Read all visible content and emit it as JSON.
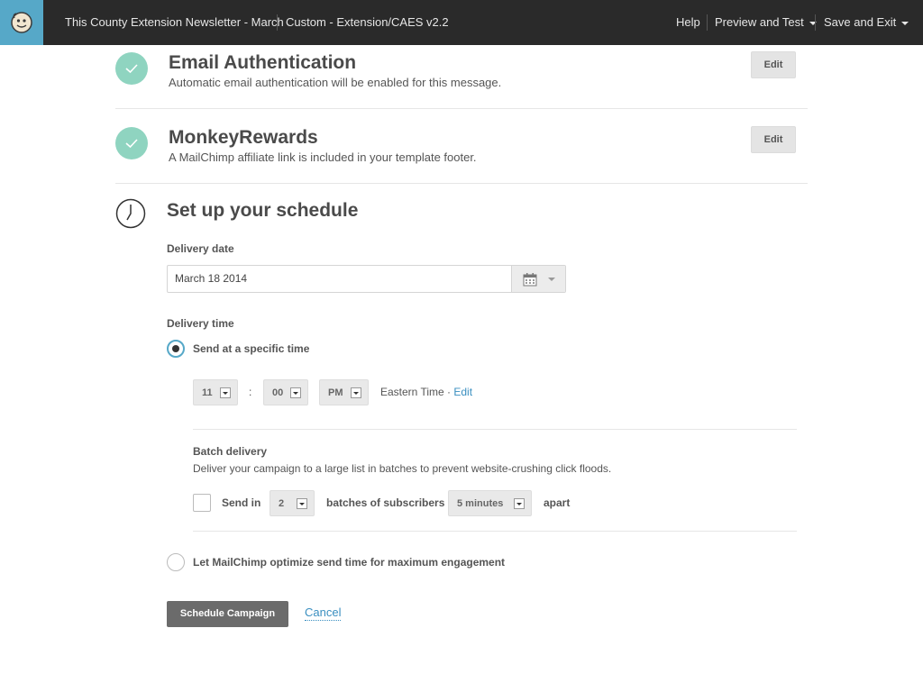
{
  "topbar": {
    "campaign_name": "This County Extension Newsletter - March",
    "template_name": "Custom - Extension/CAES v2.2",
    "help": "Help",
    "preview_test": "Preview and Test",
    "save_exit": "Save and Exit"
  },
  "email_auth": {
    "title": "Email Authentication",
    "desc": "Automatic email authentication will be enabled for this message.",
    "edit": "Edit"
  },
  "monkey_rewards": {
    "title": "MonkeyRewards",
    "desc": "A MailChimp affiliate link is included in your template footer.",
    "edit": "Edit"
  },
  "schedule": {
    "title": "Set up your schedule",
    "delivery_date_label": "Delivery date",
    "delivery_date_value": "March 18 2014",
    "delivery_time_label": "Delivery time",
    "specific_time_label": "Send at a specific time",
    "hour": "11",
    "colon": ":",
    "minute": "00",
    "ampm": "PM",
    "timezone": "Eastern Time ·",
    "timezone_edit": "Edit",
    "batch_title": "Batch delivery",
    "batch_desc": "Deliver your campaign to a large list in batches to prevent website-crushing click floods.",
    "send_in": "Send in",
    "batch_count": "2",
    "batches_of": "batches of subscribers",
    "interval": "5 minutes",
    "apart": "apart",
    "optimize_label": "Let MailChimp optimize send time for maximum engagement",
    "schedule_btn": "Schedule Campaign",
    "cancel": "Cancel"
  },
  "colors": {
    "topbar": "#2a2a2a",
    "logo_bg": "#56a8c8",
    "check": "#8fd4c0",
    "link": "#3a8fc0",
    "primary_button": "#6b6b6b"
  }
}
